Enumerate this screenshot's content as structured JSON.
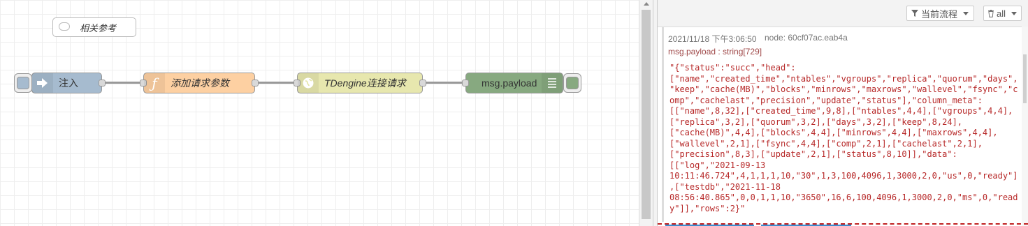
{
  "workspace": {
    "comment_label": "相关参考",
    "nodes": [
      {
        "id": "inject",
        "label": "注入",
        "color": "#a6bbcf",
        "icon": "arrow-right-icon"
      },
      {
        "id": "function",
        "label": "添加请求参数",
        "color": "#fdd0a2",
        "icon": "function-icon"
      },
      {
        "id": "http",
        "label": "TDengine连接请求",
        "color": "#e7e7ae",
        "icon": "globe-icon"
      },
      {
        "id": "debug",
        "label": "msg.payload",
        "color": "#87a980",
        "icon": "list-icon"
      }
    ]
  },
  "sidebar": {
    "filter_label": "当前流程",
    "clear_label": "all",
    "message": {
      "timestamp": "2021/11/18 下午3:06:50",
      "node": "node: 60cf07ac.eab4a",
      "topic": "msg.payload : string[729]",
      "payload": "\"{\"status\":\"succ\",\"head\":\n[\"name\",\"created_time\",\"ntables\",\"vgroups\",\"replica\",\"quorum\",\"days\",\n\"keep\",\"cache(MB)\",\"blocks\",\"minrows\",\"maxrows\",\"wallevel\",\"fsync\",\"c\nomp\",\"cachelast\",\"precision\",\"update\",\"status\"],\"column_meta\":\n[[\"name\",8,32],[\"created_time\",9,8],[\"ntables\",4,4],[\"vgroups\",4,4],\n[\"replica\",3,2],[\"quorum\",3,2],[\"days\",3,2],[\"keep\",8,24],\n[\"cache(MB)\",4,4],[\"blocks\",4,4],[\"minrows\",4,4],[\"maxrows\",4,4],\n[\"wallevel\",2,1],[\"fsync\",4,4],[\"comp\",2,1],[\"cachelast\",2,1],\n[\"precision\",8,3],[\"update\",2,1],[\"status\",8,10]],\"data\":\n[[\"log\",\"2021-09-13\n10:11:46.724\",4,1,1,1,10,\"30\",1,3,100,4096,1,3000,2,0,\"us\",0,\"ready\"]\n,[\"testdb\",\"2021-11-18\n08:56:40.865\",0,0,1,1,10,\"3650\",16,6,100,4096,1,3000,2,0,\"ms\",0,\"read\ny\"]],\"rows\":2}\""
    }
  }
}
